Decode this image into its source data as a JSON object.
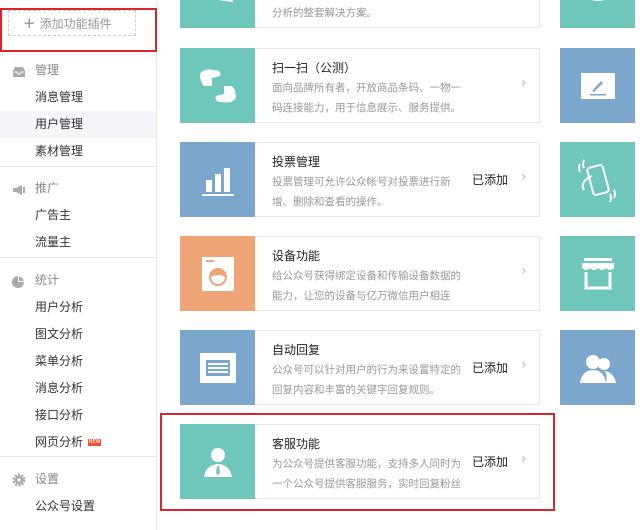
{
  "sidebar": {
    "add_plugin": "添加功能插件",
    "sections": [
      {
        "title": "管理",
        "icon": "inbox-icon",
        "items": [
          "消息管理",
          "用户管理",
          "素材管理"
        ]
      },
      {
        "title": "推广",
        "icon": "megaphone-icon",
        "items": [
          "广告主",
          "流量主"
        ]
      },
      {
        "title": "统计",
        "icon": "pie-chart-icon",
        "items": [
          "用户分析",
          "图文分析",
          "菜单分析",
          "消息分析",
          "接口分析",
          "网页分析"
        ]
      },
      {
        "title": "设置",
        "icon": "gear-icon",
        "items": [
          "公众号设置"
        ]
      }
    ],
    "active": "用户管理",
    "new_badge": "NEW"
  },
  "cards": [
    {
      "title": "",
      "desc": "分析的整套解决方案。",
      "status": "",
      "icon": "chart-icon",
      "color": "#6fc7bb"
    },
    {
      "title": "扫一扫（公测）",
      "desc": "面向品牌所有者，开放商品条码、一物一码连接能力，用于信息展示、服务提供。",
      "status": "",
      "icon": "scan-icon",
      "color": "#6fc7bb"
    },
    {
      "title": "投票管理",
      "desc": "投票管理可允许公众帐号对投票进行新增、删除和查看的操作。",
      "status": "已添加",
      "icon": "bar-chart-icon",
      "color": "#7aa7cb"
    },
    {
      "title": "设备功能",
      "desc": "给公众号获得绑定设备和传输设备数据的能力，让您的设备与亿万微信用户相连接。",
      "status": "",
      "icon": "washing-machine-icon",
      "color": "#efa476"
    },
    {
      "title": "自动回复",
      "desc": "公众号可以针对用户的行为来设置特定的回复内容和丰富的关键字回复规则。",
      "status": "已添加",
      "icon": "message-icon",
      "color": "#7aa7cb"
    },
    {
      "title": "客服功能",
      "desc": "为公众号提供客服功能，支持多人同时为一个公众号提供客服服务，实时回复粉丝咨询。",
      "status": "已添加",
      "icon": "customer-service-icon",
      "color": "#6fc7bb"
    }
  ],
  "right_tiles": [
    "chat-bubble-icon",
    "edit-icon",
    "shake-phone-icon",
    "shop-icon",
    "users-icon"
  ]
}
